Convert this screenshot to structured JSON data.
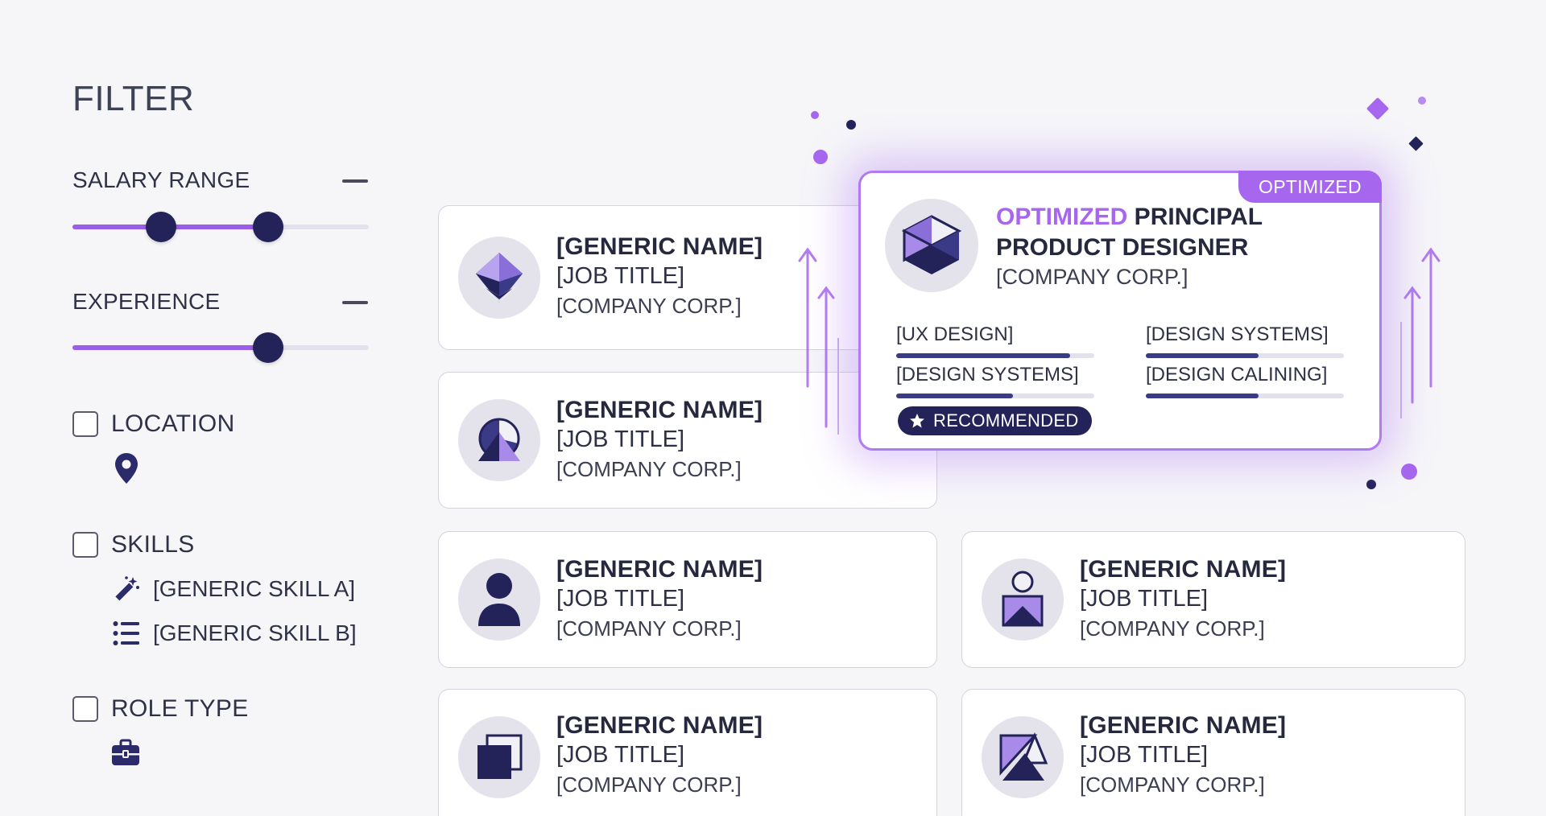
{
  "filter": {
    "title": "FILTER",
    "salary_range": {
      "label": "SALARY RANGE",
      "low": 0.3,
      "high": 0.66
    },
    "experience": {
      "label": "EXPERIENCE",
      "value": 0.66
    },
    "location": {
      "label": "LOCATION",
      "checked": false
    },
    "skills": {
      "label": "SKILLS",
      "checked": false,
      "items": [
        {
          "label": "[GENERIC SKILL A]",
          "icon": "magic-wand-icon"
        },
        {
          "label": "[GENERIC SKILL B]",
          "icon": "list-icon"
        }
      ]
    },
    "role_type": {
      "label": "ROLE TYPE",
      "checked": false
    }
  },
  "cards": [
    {
      "name": "[GENERIC NAME]",
      "title": "[JOB TITLE]",
      "company": "[COMPANY CORP.]",
      "icon": "gem-icon"
    },
    {
      "name": "[GENERIC NAME]",
      "title": "[JOB TITLE]",
      "company": "[COMPANY CORP.]",
      "icon": "pie-shape-icon"
    },
    {
      "name": "[GENERIC NAME]",
      "title": "[JOB TITLE]",
      "company": "[COMPANY CORP.]",
      "icon": "person-icon"
    },
    {
      "name": "[GENERIC NAME]",
      "title": "[JOB TITLE]",
      "company": "[COMPANY CORP.]",
      "icon": "person-triangle-icon"
    },
    {
      "name": "[GENERIC NAME]",
      "title": "[JOB TITLE]",
      "company": "[COMPANY CORP.]",
      "icon": "squares-icon"
    },
    {
      "name": "[GENERIC NAME]",
      "title": "[JOB TITLE]",
      "company": "[COMPANY CORP.]",
      "icon": "triangles-icon"
    }
  ],
  "featured": {
    "badge": "OPTIMIZED",
    "title_accent": "OPTIMIZED",
    "title_rest_1": " PRINCIPAL",
    "title_rest_2": "PRODUCT DESIGNER",
    "company": "[COMPANY CORP.]",
    "skills": [
      {
        "label": "[UX DESIGN]",
        "level": 0.88
      },
      {
        "label": "[DESIGN SYSTEMS]",
        "level": 0.57
      },
      {
        "label": "[DESIGN SYSTEMS]",
        "level": 0.59
      },
      {
        "label": "[DESIGN CALINING]",
        "level": 0.57
      }
    ],
    "recommended": "RECOMMENDED"
  },
  "colors": {
    "accent": "#a667ee",
    "navy": "#23235a",
    "track_fill": "#9a5ee8"
  }
}
